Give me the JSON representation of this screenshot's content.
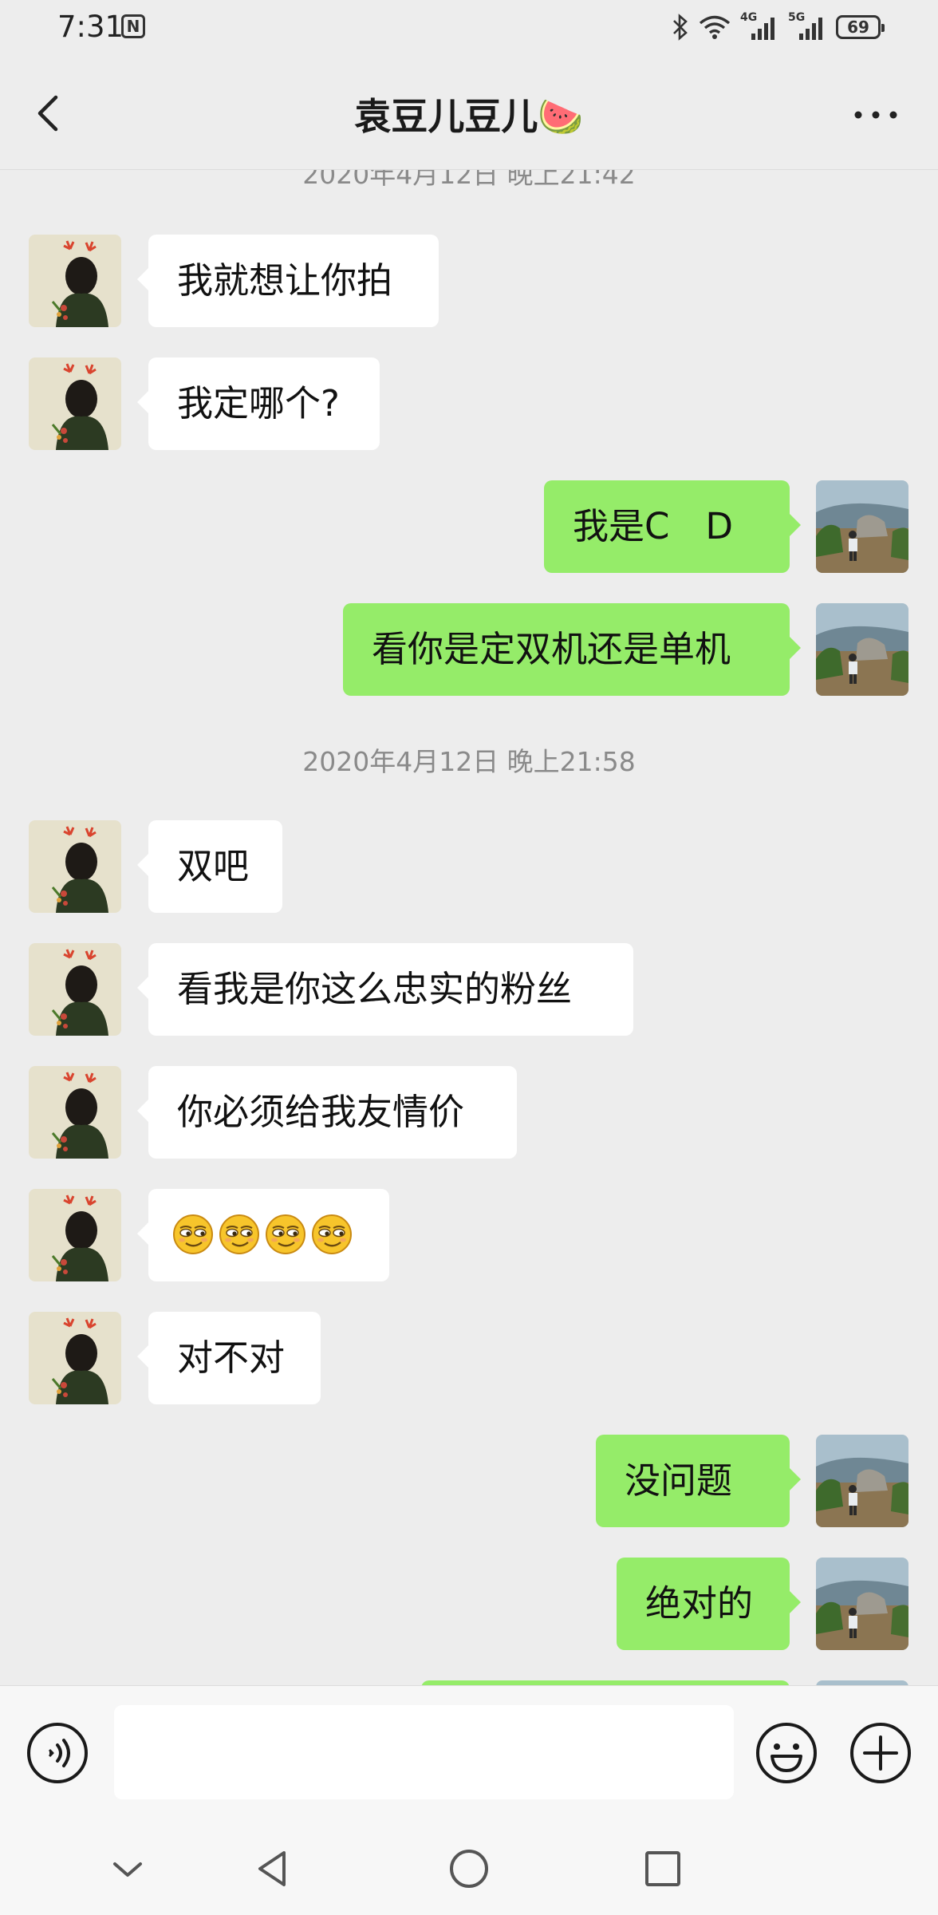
{
  "status_bar": {
    "time": "7:31",
    "battery": "69",
    "network_1": "4G",
    "network_2": "5G",
    "icons": [
      "nfc-icon",
      "bluetooth-icon",
      "wifi-icon",
      "signal-icon",
      "signal-icon",
      "battery-icon"
    ]
  },
  "header": {
    "title": "袁豆儿豆儿🍉",
    "back_icon": "chevron-left-icon",
    "more_icon": "more-dots-icon"
  },
  "chat": {
    "timestamps": [
      "2020年4月12日 晚上21:42",
      "2020年4月12日 晚上21:58"
    ],
    "messages": [
      {
        "side": "in",
        "text": "我就想让你拍"
      },
      {
        "side": "in",
        "text": "我定哪个?"
      },
      {
        "side": "out",
        "text": "我是C　D"
      },
      {
        "side": "out",
        "text": "看你是定双机还是单机"
      },
      {
        "side": "in",
        "text": "双吧"
      },
      {
        "side": "in",
        "text": "看我是你这么忠实的粉丝"
      },
      {
        "side": "in",
        "text": "你必须给我友情价"
      },
      {
        "side": "in",
        "emoji": "smirk-face-emoji",
        "emoji_count": 4
      },
      {
        "side": "in",
        "text": "对不对"
      },
      {
        "side": "out",
        "text": "没问题"
      },
      {
        "side": "out",
        "text": "绝对的"
      },
      {
        "side": "out",
        "text": ""
      }
    ],
    "colors": {
      "background": "#ededed",
      "incoming_bubble": "#ffffff",
      "outgoing_bubble": "#95ec69",
      "timestamp": "#8a8a8a"
    }
  },
  "input_bar": {
    "message_value": "",
    "icons": [
      "voice-icon",
      "emoji-icon",
      "plus-icon"
    ]
  },
  "nav_bar": {
    "icons": [
      "chevron-down-icon",
      "back-triangle-icon",
      "home-circle-icon",
      "recents-square-icon"
    ]
  }
}
